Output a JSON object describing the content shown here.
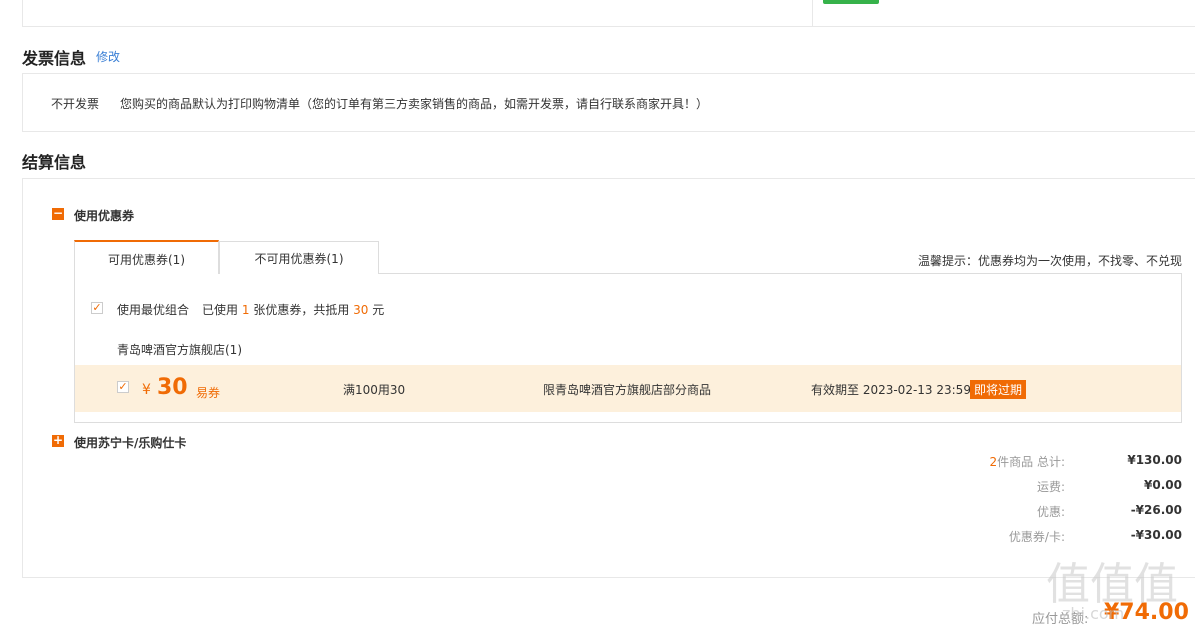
{
  "invoice": {
    "title": "发票信息",
    "edit_label": "修改",
    "type": "不开发票",
    "note": "您购买的商品默认为打印购物清单（您的订单有第三方卖家销售的商品，如需开发票，请自行联系商家开具！）"
  },
  "settlement": {
    "title": "结算信息",
    "coupon_toggle_label": "使用优惠券",
    "tabs": [
      {
        "label": "可用优惠券(1)",
        "active": true
      },
      {
        "label": "不可用优惠券(1)",
        "active": false
      }
    ],
    "tip": "温馨提示：优惠券均为一次使用，不找零、不兑现",
    "best_combo": {
      "checked": true,
      "label": "使用最优组合",
      "used_prefix": "已使用",
      "used_count": "1",
      "used_mid": "张优惠券，共抵用",
      "used_amount": "30",
      "used_suffix": "元"
    },
    "store_name": "青岛啤酒官方旗舰店(1)",
    "coupon": {
      "checked": true,
      "currency": "¥",
      "amount": "30",
      "type": "易券",
      "condition": "满100用30",
      "scope": "限青岛啤酒官方旗舰店部分商品",
      "validity": "有效期至 2023-02-13 23:59",
      "badge": "即将过期"
    },
    "card_toggle_label": "使用苏宁卡/乐购仕卡"
  },
  "summary": {
    "items": [
      {
        "label_count": "2",
        "label": "件商品 总计:",
        "value": "¥130.00"
      },
      {
        "label": "运费:",
        "value": "¥0.00"
      },
      {
        "label": "优惠:",
        "value": "-¥26.00"
      },
      {
        "label": "优惠券/卡:",
        "value": "-¥30.00"
      }
    ],
    "pay_label": "应付总额:",
    "pay_value": "¥74.00"
  },
  "watermark": {
    "text": "值值值",
    "url": "zhi.com"
  },
  "colors": {
    "accent": "#f06b05",
    "link": "#3a7fd5",
    "coupon_bg": "#fdf0dc"
  }
}
